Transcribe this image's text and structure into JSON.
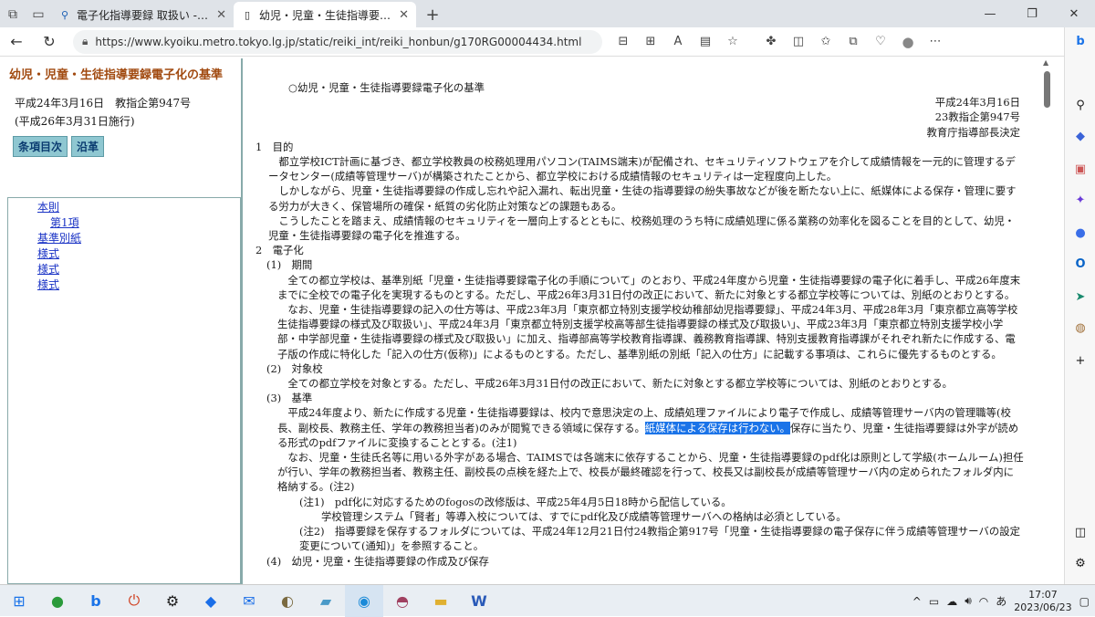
{
  "browser": {
    "tabs": [
      {
        "label": "電子化指導要録 取扱い - Search"
      },
      {
        "label": "幼児・児童・生徒指導要録電子化の基準"
      }
    ],
    "url": "https://www.kyoiku.metro.tokyo.lg.jp/static/reiki_int/reiki_honbun/g170RG00004434.html"
  },
  "left": {
    "title": "幼児・児童・生徒指導要録電子化の基準",
    "meta1": "平成24年3月16日　教指企第947号",
    "meta2": "(平成26年3月31日施行)",
    "tab1": "条項目次",
    "tab2": "沿革",
    "links": [
      "本則",
      "第1項",
      "基準別紙",
      "様式",
      "様式",
      "様式"
    ]
  },
  "doc": {
    "title": "○幼児・児童・生徒指導要録電子化の基準",
    "date": "平成24年3月16日",
    "number": "23教指企第947号",
    "issuer": "教育庁指導部長決定",
    "s1": "1　目的",
    "s1p1": "都立学校ICT計画に基づき、都立学校教員の校務処理用パソコン(TAIMS端末)が配備され、セキュリティソフトウェアを介して成績情報を一元的に管理するデータセンター(成績等管理サーバ)が構築されたことから、都立学校における成績情報のセキュリティは一定程度向上した。",
    "s1p2": "しかしながら、児童・生徒指導要録の作成し忘れや記入漏れ、転出児童・生徒の指導要録の紛失事故などが後を断たない上に、紙媒体による保存・管理に要する労力が大きく、保管場所の確保・紙質の劣化防止対策などの課題もある。",
    "s1p3": "こうしたことを踏まえ、成績情報のセキュリティを一層向上するとともに、校務処理のうち特に成績処理に係る業務の効率化を図ることを目的として、幼児・児童・生徒指導要録の電子化を推進する。",
    "s2": "2　電子化",
    "s2_1": "(1)　期間",
    "s2_1p1": "全ての都立学校は、基準別紙「児童・生徒指導要録電子化の手順について」のとおり、平成24年度から児童・生徒指導要録の電子化に着手し、平成26年度末までに全校での電子化を実現するものとする。ただし、平成26年3月31日付の改正において、新たに対象とする都立学校等については、別紙のとおりとする。",
    "s2_1p2": "なお、児童・生徒指導要録の記入の仕方等は、平成23年3月「東京都立特別支援学校幼稚部幼児指導要録」、平成24年3月、平成28年3月「東京都立高等学校生徒指導要録の様式及び取扱い」、平成24年3月「東京都立特別支援学校高等部生徒指導要録の様式及び取扱い」、平成23年3月「東京都立特別支援学校小学部・中学部児童・生徒指導要録の様式及び取扱い」に加え、指導部高等学校教育指導課、義務教育指導課、特別支援教育指導課がそれぞれ新たに作成する、電子版の作成に特化した「記入の仕方(仮称)」によるものとする。ただし、基準別紙の別紙「記入の仕方」に記載する事項は、これらに優先するものとする。",
    "s2_2": "(2)　対象校",
    "s2_2p1": "全ての都立学校を対象とする。ただし、平成26年3月31日付の改正において、新たに対象とする都立学校等については、別紙のとおりとする。",
    "s2_3": "(3)　基準",
    "s2_3p1a": "平成24年度より、新たに作成する児童・生徒指導要録は、校内で意思決定の上、成績処理ファイルにより電子で作成し、成績等管理サーバ内の管理職等(校長、副校長、教務主任、学年の教務担当者)のみが閲覧できる領域に保存する。",
    "s2_3p1hl": "紙媒体による保存は行わない。",
    "s2_3p1b": "保存に当たり、児童・生徒指導要録は外字が読める形式のpdfファイルに変換することとする。(注1)",
    "s2_3p2": "なお、児童・生徒氏名等に用いる外字がある場合、TAIMSでは各端末に依存することから、児童・生徒指導要録のpdf化は原則として学級(ホームルーム)担任が行い、学年の教務担当者、教務主任、副校長の点検を経た上で、校長が最終確認を行って、校長又は副校長が成績等管理サーバ内の定められたフォルダ内に格納する。(注2)",
    "note1": "(注1)　pdf化に対応するためのfogosの改修版は、平成25年4月5日18時から配信している。",
    "note1b": "学校管理システム「賢者」等導入校については、すでにpdf化及び成績等管理サーバへの格納は必須としている。",
    "note2": "(注2)　指導要録を保存するフォルダについては、平成24年12月21日付24教指企第917号「児童・生徒指導要録の電子保存に伴う成績等管理サーバの設定変更について(通知)」を参照すること。",
    "s2_4": "(4)　幼児・児童・生徒指導要録の作成及び保存"
  },
  "taskbar": {
    "time": "17:07",
    "date": "2023/06/23",
    "ime": "あ"
  }
}
